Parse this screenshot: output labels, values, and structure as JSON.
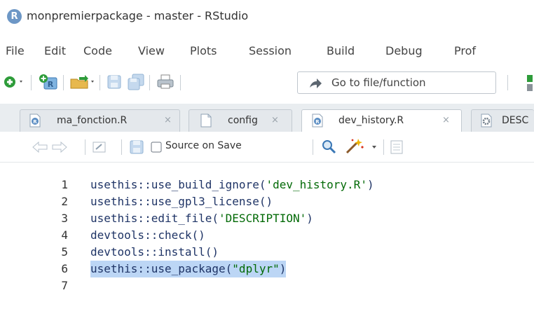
{
  "window": {
    "title": "monpremierpackage - master - RStudio",
    "logo_letter": "R"
  },
  "menu": [
    "File",
    "Edit",
    "Code",
    "View",
    "Plots",
    "Session",
    "Build",
    "Debug",
    "Prof"
  ],
  "toolbar": {
    "goto_label": "Go to file/function"
  },
  "tabs": [
    {
      "label": "ma_fonction.R",
      "close": "×"
    },
    {
      "label": "config",
      "close": "×"
    },
    {
      "label": "dev_history.R",
      "close": "×",
      "active": true
    },
    {
      "label": "DESC"
    }
  ],
  "editor_toolbar": {
    "source_on_save": "Source on Save"
  },
  "code": {
    "lines": [
      {
        "num": "1",
        "code": "usethis::use_build_ignore(",
        "str": "'dev_history.R'",
        "tail": ")"
      },
      {
        "num": "2",
        "code": "usethis::use_gpl3_license()",
        "str": "",
        "tail": ""
      },
      {
        "num": "3",
        "code": "usethis::edit_file(",
        "str": "'DESCRIPTION'",
        "tail": ")"
      },
      {
        "num": "4",
        "code": "devtools::check()",
        "str": "",
        "tail": ""
      },
      {
        "num": "5",
        "code": "devtools::install()",
        "str": "",
        "tail": ""
      },
      {
        "num": "6",
        "code": "usethis::use_package(",
        "str": "\"dplyr\"",
        "tail": ")"
      },
      {
        "num": "7",
        "code": "",
        "str": "",
        "tail": ""
      }
    ]
  }
}
